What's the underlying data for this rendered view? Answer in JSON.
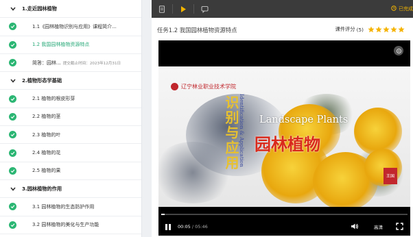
{
  "sidebar": {
    "sections": [
      {
        "title": "1.走近园林植物",
        "items": [
          {
            "label": "1.1《园林植物识别与应用》课程简介...",
            "state": "done"
          },
          {
            "label": "1.2 我国园林植物资源特点",
            "state": "active"
          },
          {
            "label": "简答：园林...",
            "meta": "提交截止时间：2023年12月31日",
            "state": "done"
          }
        ]
      },
      {
        "title": "2.植物形态学基础",
        "items": [
          {
            "label": "2.1 植物的根皮形芽",
            "state": "done"
          },
          {
            "label": "2.2 植物的茎",
            "state": "done"
          },
          {
            "label": "2.3 植物的叶",
            "state": "done"
          },
          {
            "label": "2.4 植物的花",
            "state": "done"
          },
          {
            "label": "2.5 植物的果",
            "state": "done"
          }
        ]
      },
      {
        "title": "3.园林植物的作用",
        "items": [
          {
            "label": "3.1 园林植物的生态防护作用",
            "state": "done"
          },
          {
            "label": "3.2 园林植物的美化与生产功能",
            "state": "done"
          }
        ]
      }
    ]
  },
  "toolbar": {
    "status_text": "已完成",
    "status_color": "#f2b400",
    "icons": [
      "document-icon",
      "play-icon",
      "comment-icon",
      "clock-icon"
    ]
  },
  "task": {
    "title": "任务1.2 我国园林植物资源特点",
    "rating_label": "课件评分",
    "rating_value": "(5)",
    "stars": 5
  },
  "video": {
    "school_name": "辽宁林业职业技术学院",
    "vertical_title": "识别与应用",
    "vertical_subtitle": "Identification & Application",
    "english_title": "Landscape Plants",
    "chinese_title": "园林植物",
    "seal_text": "王国",
    "current_time": "00:05",
    "total_time": "/ 05:46",
    "progress_fraction": 0.014,
    "quality": "高清"
  },
  "colors": {
    "accent_green": "#2bb673",
    "active_text": "#27a978",
    "star": "#f5b301"
  }
}
